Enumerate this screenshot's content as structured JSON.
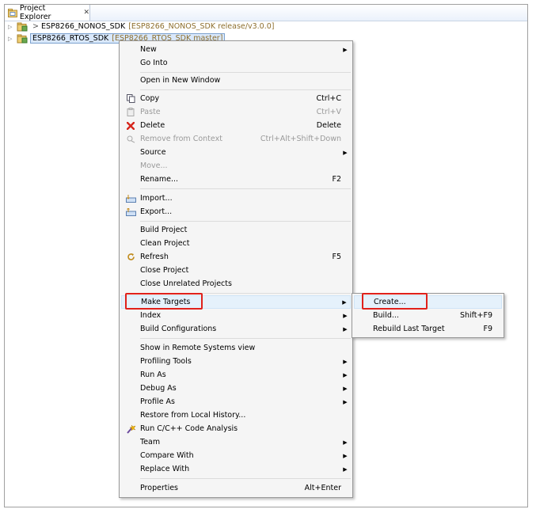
{
  "view": {
    "tab_title": "Project Explorer",
    "tab_close_glyph": "✕",
    "tab_icon": "project-explorer-icon"
  },
  "tree": {
    "items": [
      {
        "dirty": ">",
        "label": "ESP8266_NONOS_SDK",
        "sub": "[ESP8266_NONOS_SDK release/v3.0.0]",
        "selected": false
      },
      {
        "dirty": "",
        "label": "ESP8266_RTOS_SDK",
        "sub": "[ESP8266_RTOS_SDK master]",
        "selected": true
      }
    ]
  },
  "context_menu": {
    "items": [
      {
        "label": "New",
        "submenu": true
      },
      {
        "label": "Go Into"
      },
      {
        "label": "Open in New Window"
      },
      {
        "label": "Copy",
        "accel": "Ctrl+C",
        "icon": "copy-icon"
      },
      {
        "label": "Paste",
        "accel": "Ctrl+V",
        "icon": "paste-icon",
        "disabled": true
      },
      {
        "label": "Delete",
        "accel": "Delete",
        "icon": "delete-icon"
      },
      {
        "label": "Remove from Context",
        "accel": "Ctrl+Alt+Shift+Down",
        "icon": "remove-context-icon",
        "disabled": true
      },
      {
        "label": "Source",
        "submenu": true
      },
      {
        "label": "Move...",
        "disabled": true
      },
      {
        "label": "Rename...",
        "accel": "F2"
      },
      {
        "label": "Import...",
        "icon": "import-icon"
      },
      {
        "label": "Export...",
        "icon": "export-icon"
      },
      {
        "label": "Build Project"
      },
      {
        "label": "Clean Project"
      },
      {
        "label": "Refresh",
        "accel": "F5",
        "icon": "refresh-icon"
      },
      {
        "label": "Close Project"
      },
      {
        "label": "Close Unrelated Projects"
      },
      {
        "label": "Make Targets",
        "submenu": true
      },
      {
        "label": "Index",
        "submenu": true
      },
      {
        "label": "Build Configurations",
        "submenu": true
      },
      {
        "label": "Show in Remote Systems view"
      },
      {
        "label": "Profiling Tools",
        "submenu": true
      },
      {
        "label": "Run As",
        "submenu": true
      },
      {
        "label": "Debug As",
        "submenu": true
      },
      {
        "label": "Profile As",
        "submenu": true
      },
      {
        "label": "Restore from Local History..."
      },
      {
        "label": "Run C/C++ Code Analysis",
        "icon": "code-analysis-icon"
      },
      {
        "label": "Team",
        "submenu": true
      },
      {
        "label": "Compare With",
        "submenu": true
      },
      {
        "label": "Replace With",
        "submenu": true
      },
      {
        "label": "Properties",
        "accel": "Alt+Enter"
      }
    ]
  },
  "submenu": {
    "items": [
      {
        "label": "Create..."
      },
      {
        "label": "Build...",
        "accel": "Shift+F9"
      },
      {
        "label": "Rebuild Last Target",
        "accel": "F9"
      }
    ]
  },
  "colors": {
    "highlight": "#e0211b",
    "hover": "#e5f1fb",
    "selection": "#d9e8fb"
  }
}
